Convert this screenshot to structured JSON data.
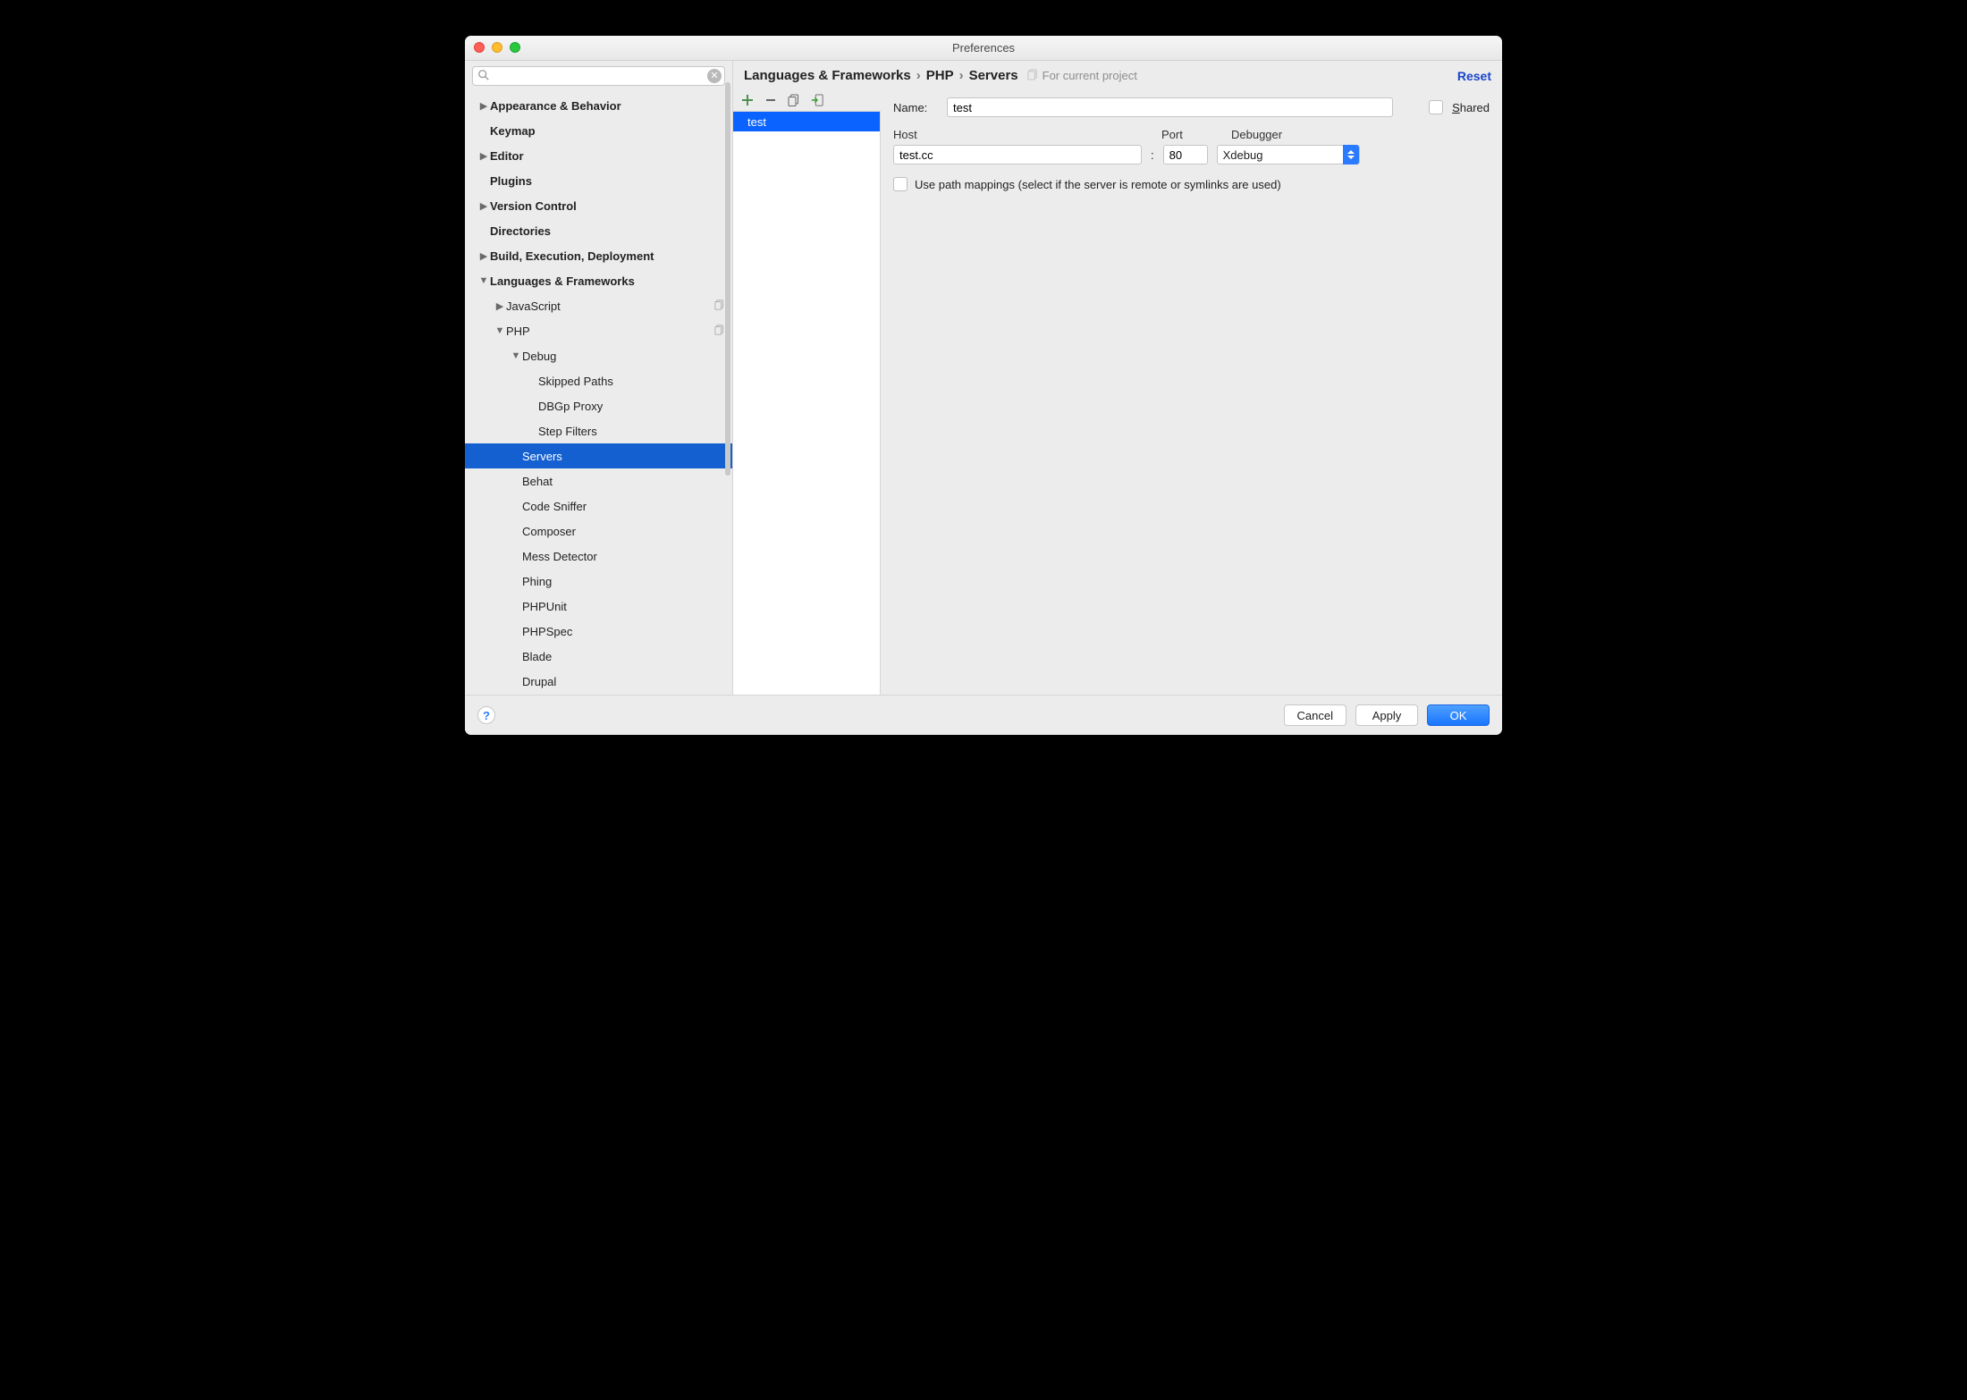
{
  "window_title": "Preferences",
  "sidebar": {
    "items": [
      {
        "label": "Appearance & Behavior",
        "bold": true,
        "arrow": "right",
        "indent": 0
      },
      {
        "label": "Keymap",
        "bold": true,
        "arrow": "",
        "indent": 0
      },
      {
        "label": "Editor",
        "bold": true,
        "arrow": "right",
        "indent": 0
      },
      {
        "label": "Plugins",
        "bold": true,
        "arrow": "",
        "indent": 0
      },
      {
        "label": "Version Control",
        "bold": true,
        "arrow": "right",
        "indent": 0
      },
      {
        "label": "Directories",
        "bold": true,
        "arrow": "",
        "indent": 0
      },
      {
        "label": "Build, Execution, Deployment",
        "bold": true,
        "arrow": "right",
        "indent": 0
      },
      {
        "label": "Languages & Frameworks",
        "bold": true,
        "arrow": "down",
        "indent": 0
      },
      {
        "label": "JavaScript",
        "bold": false,
        "arrow": "right",
        "indent": 1,
        "hint": true
      },
      {
        "label": "PHP",
        "bold": false,
        "arrow": "down",
        "indent": 1,
        "hint": true
      },
      {
        "label": "Debug",
        "bold": false,
        "arrow": "down",
        "indent": 2
      },
      {
        "label": "Skipped Paths",
        "bold": false,
        "arrow": "",
        "indent": 3
      },
      {
        "label": "DBGp Proxy",
        "bold": false,
        "arrow": "",
        "indent": 3
      },
      {
        "label": "Step Filters",
        "bold": false,
        "arrow": "",
        "indent": 3
      },
      {
        "label": "Servers",
        "bold": false,
        "arrow": "",
        "indent": 2,
        "selected": true
      },
      {
        "label": "Behat",
        "bold": false,
        "arrow": "",
        "indent": 2
      },
      {
        "label": "Code Sniffer",
        "bold": false,
        "arrow": "",
        "indent": 2
      },
      {
        "label": "Composer",
        "bold": false,
        "arrow": "",
        "indent": 2
      },
      {
        "label": "Mess Detector",
        "bold": false,
        "arrow": "",
        "indent": 2
      },
      {
        "label": "Phing",
        "bold": false,
        "arrow": "",
        "indent": 2
      },
      {
        "label": "PHPUnit",
        "bold": false,
        "arrow": "",
        "indent": 2
      },
      {
        "label": "PHPSpec",
        "bold": false,
        "arrow": "",
        "indent": 2
      },
      {
        "label": "Blade",
        "bold": false,
        "arrow": "",
        "indent": 2
      },
      {
        "label": "Drupal",
        "bold": false,
        "arrow": "",
        "indent": 2
      }
    ]
  },
  "breadcrumb": {
    "parts": [
      "Languages & Frameworks",
      "PHP",
      "Servers"
    ],
    "note": "For current project",
    "reset": "Reset"
  },
  "serverlist": {
    "items": [
      "test"
    ],
    "selected": 0
  },
  "form": {
    "name_label": "Name:",
    "name_value": "test",
    "shared_label": "Shared",
    "host_label": "Host",
    "port_label": "Port",
    "debugger_label": "Debugger",
    "host_value": "test.cc",
    "port_value": "80",
    "debugger_value": "Xdebug",
    "path_mappings_label": "Use path mappings (select if the server is remote or symlinks are used)"
  },
  "footer": {
    "cancel": "Cancel",
    "apply": "Apply",
    "ok": "OK"
  }
}
